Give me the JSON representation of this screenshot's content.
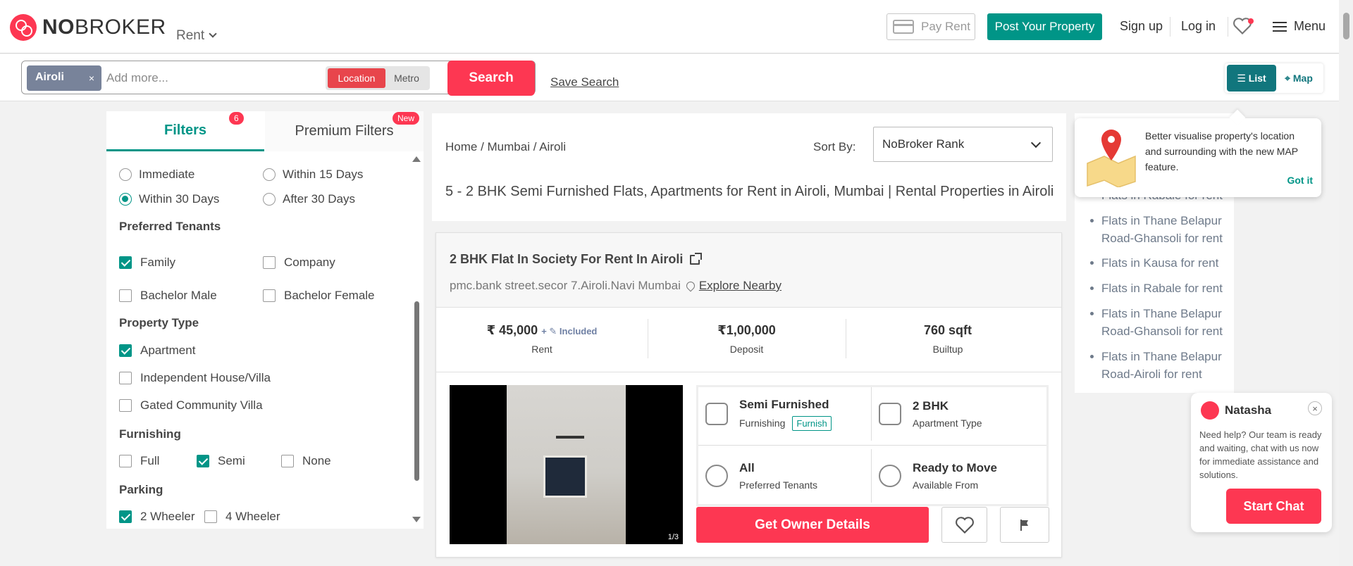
{
  "header": {
    "logo_no": "NO",
    "logo_broker": "BROKER",
    "rent_dropdown": "Rent",
    "pay_rent": "Pay Rent",
    "post_property": "Post Your Property",
    "sign_up": "Sign up",
    "log_in": "Log in",
    "menu": "Menu"
  },
  "search": {
    "chip": "Airoli",
    "chip_close": "×",
    "placeholder": "Add more...",
    "location": "Location",
    "metro": "Metro",
    "search_button": "Search",
    "save_search": "Save Search",
    "view_list": "List",
    "view_map": "Map"
  },
  "filters": {
    "tab_filters": "Filters",
    "tab_filters_badge": "6",
    "tab_premium": "Premium Filters",
    "tab_premium_badge": "New",
    "availability": [
      {
        "label": "Immediate",
        "checked": false
      },
      {
        "label": "Within 15 Days",
        "checked": false
      },
      {
        "label": "Within 30 Days",
        "checked": true
      },
      {
        "label": "After 30 Days",
        "checked": false
      }
    ],
    "tenants_heading": "Preferred Tenants",
    "tenants": [
      {
        "label": "Family",
        "checked": true
      },
      {
        "label": "Company",
        "checked": false
      },
      {
        "label": "Bachelor Male",
        "checked": false
      },
      {
        "label": "Bachelor Female",
        "checked": false
      }
    ],
    "property_heading": "Property Type",
    "property_types": [
      {
        "label": "Apartment",
        "checked": true
      },
      {
        "label": "Independent House/Villa",
        "checked": false
      },
      {
        "label": "Gated Community Villa",
        "checked": false
      }
    ],
    "furnishing_heading": "Furnishing",
    "furnishing": [
      {
        "label": "Full",
        "checked": false
      },
      {
        "label": "Semi",
        "checked": true
      },
      {
        "label": "None",
        "checked": false
      }
    ],
    "parking_heading": "Parking",
    "parking": [
      {
        "label": "2 Wheeler",
        "checked": true
      },
      {
        "label": "4 Wheeler",
        "checked": false
      }
    ]
  },
  "main": {
    "breadcrumb": "Home  / Mumbai / Airoli",
    "sort_by_label": "Sort By:",
    "sort_by_value": "NoBroker Rank",
    "title": "5 - 2 BHK Semi Furnished Flats, Apartments for Rent in Airoli, Mumbai | Rental Properties in Airoli"
  },
  "listing": {
    "title": "2 BHK Flat In Society For Rent In Airoli",
    "address": "pmc.bank street.secor 7.Airoli.Navi Mumbai",
    "explore": "Explore Nearby",
    "rent_value": "₹ 45,000",
    "rent_included": "+ ✎ Included",
    "rent_label": "Rent",
    "deposit_value": "₹1,00,000",
    "deposit_label": "Deposit",
    "builtup_value": "760 sqft",
    "builtup_label": "Builtup",
    "photo_count": "1/3",
    "furnishing_value": "Semi Furnished",
    "furnishing_label": "Furnishing",
    "furnish_tag": "Furnish",
    "apartment_value": "2 BHK",
    "apartment_label": "Apartment Type",
    "tenants_value": "All",
    "tenants_label": "Preferred Tenants",
    "available_value": "Ready to Move",
    "available_label": "Available From",
    "get_owner": "Get Owner Details"
  },
  "right_panel": {
    "links": [
      "Flats in Rabale for rent",
      "Flats in Thane Belapur Road-Ghansoli for rent",
      "Flats in Kausa for rent",
      "Flats in Rabale for rent",
      "Flats in Thane Belapur Road-Ghansoli for rent",
      "Flats in Thane Belapur Road-Airoli for rent"
    ],
    "tip_text": "Better visualise property's location and surrounding with the new MAP feature.",
    "tip_got_it": "Got it"
  },
  "chat": {
    "name": "Natasha",
    "close": "×",
    "message": "Need help? Our team is ready and waiting, chat with us now for immediate assistance and solutions.",
    "start_chat": "Start Chat"
  },
  "colors": {
    "brand_red": "#fd3752",
    "brand_teal": "#009587",
    "view_teal": "#11767d"
  }
}
